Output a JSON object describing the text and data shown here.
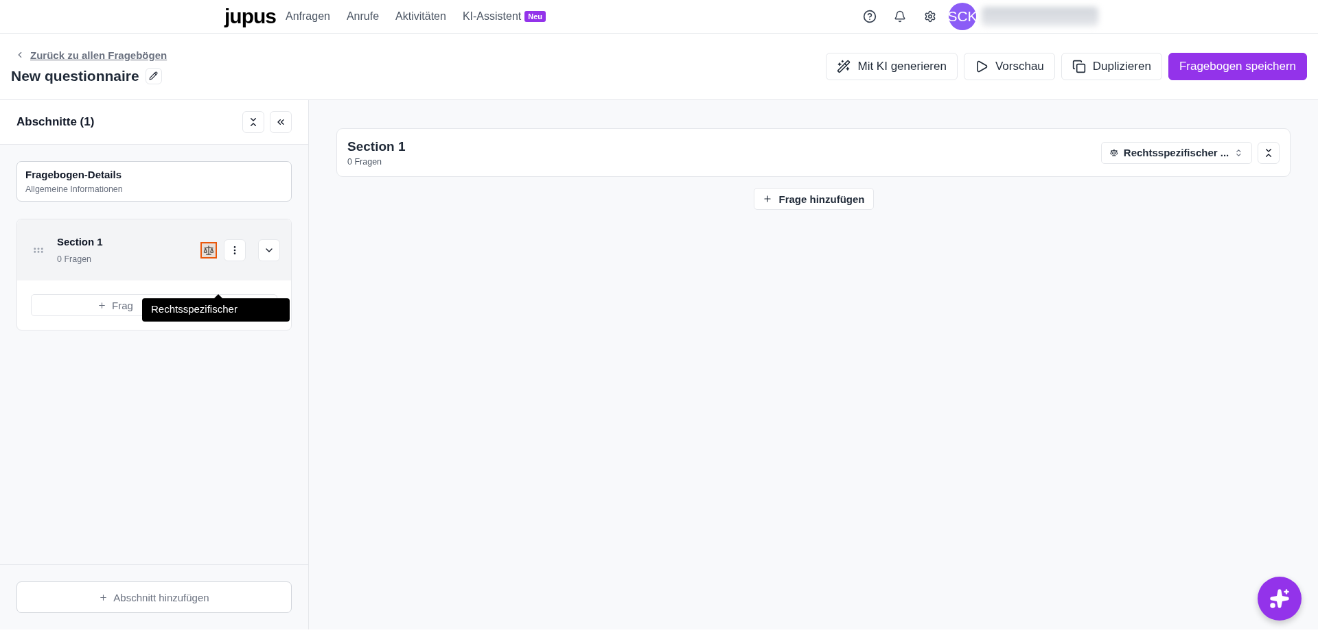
{
  "topbar": {
    "logo": "jupus",
    "nav": [
      {
        "label": "Anfragen"
      },
      {
        "label": "Anrufe"
      },
      {
        "label": "Aktivitäten"
      },
      {
        "label": "KI-Assistent",
        "badge": "Neu"
      }
    ],
    "avatar": "SCK"
  },
  "header": {
    "back_link": "Zurück zu allen Fragebögen",
    "title": "New questionnaire",
    "buttons": [
      {
        "label": "Mit KI generieren",
        "kind": "wand"
      },
      {
        "label": "Vorschau",
        "kind": "play"
      },
      {
        "label": "Duplizieren",
        "kind": "copy"
      },
      {
        "label": "Fragebogen speichern",
        "kind": "primary"
      }
    ]
  },
  "sidebar": {
    "title": "Abschnitte (1)",
    "details": {
      "title": "Fragebogen-Details",
      "subtitle": "Allgemeine Informationen"
    },
    "sections": [
      {
        "title": "Section 1",
        "count": "0 Fragen",
        "add_question": "Frag",
        "tooltip": "Rechtsspezifischer"
      }
    ],
    "add_section": "Abschnitt hinzufügen"
  },
  "main": {
    "sections": [
      {
        "title": "Section 1",
        "count": "0 Fragen",
        "type_select": "Rechtsspezifischer ..."
      }
    ],
    "add_question": "Frage hinzufügen"
  }
}
